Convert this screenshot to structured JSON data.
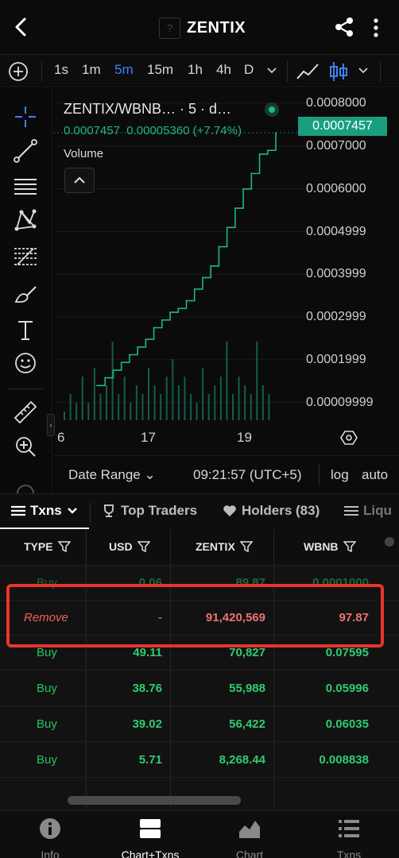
{
  "header": {
    "title": "ZENTIX",
    "logo_glyph": "?"
  },
  "timeframes": {
    "items": [
      "1s",
      "1m",
      "5m",
      "15m",
      "1h",
      "4h",
      "D"
    ],
    "active": "5m"
  },
  "chart": {
    "pair_label": "ZENTIX/WBNB… · 5 · d…",
    "last_price": "0.0007457",
    "change_abs": "0.00005360",
    "change_pct": "(+7.74%)",
    "volume_label": "Volume",
    "price_tag": "0.0007457",
    "y_ticks": [
      "0.0008000",
      "0.0007000",
      "0.0006000",
      "0.0004999",
      "0.0003999",
      "0.0002999",
      "0.0001999",
      "0.00009999"
    ],
    "x_ticks": [
      "6",
      "17",
      "19"
    ],
    "date_range_label": "Date Range",
    "time_label": "09:21:57 (UTC+5)",
    "log_label": "log",
    "auto_label": "auto",
    "accent_color": "#1db58e"
  },
  "chart_data": {
    "type": "line",
    "title": "ZENTIX/WBNB… · 5 · d…",
    "xlabel": "",
    "ylabel": "",
    "x_ticks": [
      "6",
      "17",
      "19"
    ],
    "ylim": [
      0.0,
      0.00082
    ],
    "series": [
      {
        "values": [
          9e-05,
          0.00011,
          0.00013,
          0.00015,
          0.00017,
          0.00019,
          0.00021,
          0.00024,
          0.00026,
          0.00028,
          0.00029,
          0.00031,
          0.00034,
          0.00037,
          0.0004,
          0.00045,
          0.0005,
          0.00055,
          0.0006,
          0.00064,
          0.00069,
          0.0007,
          0.0007457
        ]
      },
      {
        "name": "Volume",
        "values": [
          0.1,
          0.3,
          0.2,
          0.5,
          0.2,
          0.6,
          0.3,
          0.4,
          0.9,
          0.3,
          0.5,
          0.2,
          0.4,
          0.3,
          0.6,
          0.4,
          0.3,
          0.5,
          0.7,
          0.4,
          0.5,
          0.3,
          0.2,
          0.6,
          0.3,
          0.4,
          0.5,
          0.9,
          0.3,
          0.5,
          0.4,
          0.3,
          0.9,
          0.4,
          0.3
        ]
      }
    ],
    "grid": true
  },
  "tabs": {
    "items": [
      "Txns",
      "Top Traders",
      "Holders (83)",
      "Liqu"
    ]
  },
  "table": {
    "columns": [
      "TYPE",
      "USD",
      "ZENTIX",
      "WBNB"
    ],
    "rows": [
      {
        "type": "Buy",
        "usd": "0.06",
        "zentix": "89.87",
        "wbnb": "0.0001000"
      },
      {
        "type": "Remove",
        "usd": "-",
        "zentix": "91,420,569",
        "wbnb": "97.87"
      },
      {
        "type": "Buy",
        "usd": "49.11",
        "zentix": "70,827",
        "wbnb": "0.07595"
      },
      {
        "type": "Buy",
        "usd": "38.76",
        "zentix": "55,988",
        "wbnb": "0.05996"
      },
      {
        "type": "Buy",
        "usd": "39.02",
        "zentix": "56,422",
        "wbnb": "0.06035"
      },
      {
        "type": "Buy",
        "usd": "5.71",
        "zentix": "8,268.44",
        "wbnb": "0.008838"
      }
    ]
  },
  "bottom_nav": {
    "items": [
      "Info",
      "Chart+Txns",
      "Chart",
      "Txns"
    ],
    "active": "Chart+Txns"
  }
}
